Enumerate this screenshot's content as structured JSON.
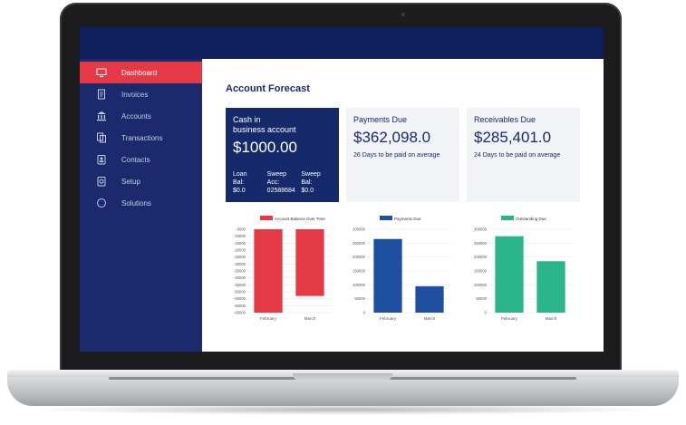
{
  "sidebar": {
    "items": [
      {
        "label": "Dashboard",
        "icon": "monitor-icon",
        "active": true
      },
      {
        "label": "Invoices",
        "icon": "invoice-icon",
        "active": false
      },
      {
        "label": "Accounts",
        "icon": "bank-icon",
        "active": false
      },
      {
        "label": "Transactions",
        "icon": "transactions-icon",
        "active": false
      },
      {
        "label": "Contacts",
        "icon": "contacts-icon",
        "active": false
      },
      {
        "label": "Setup",
        "icon": "setup-icon",
        "active": false
      },
      {
        "label": "Solutions",
        "icon": "circle-icon",
        "active": false
      }
    ]
  },
  "main": {
    "title": "Account Forecast",
    "cash_card": {
      "label_line1": "Cash in",
      "label_line2": "business account",
      "value": "$1000.00",
      "sub": [
        {
          "l1": "Loan",
          "l2": "Bal:",
          "l3": "$0.0"
        },
        {
          "l1": "Sweep",
          "l2": "Acc:",
          "l3": "02588684"
        },
        {
          "l1": "Sweep",
          "l2": "Bal:",
          "l3": "$0.0"
        }
      ]
    },
    "payments_card": {
      "label": "Payments Due",
      "value": "$362,098.0",
      "note": "26 Days to be paid on average"
    },
    "receivables_card": {
      "label": "Receivables Due",
      "value": "$285,401.0",
      "note": "24 Days to be paid on average"
    }
  },
  "colors": {
    "topbar": "#0f1f5c",
    "sidebar": "#1a2a6c",
    "accent": "#e63946",
    "bar_red": "#e63946",
    "bar_blue": "#1f4fa0",
    "bar_green": "#2bb58a"
  },
  "chart_data": [
    {
      "type": "bar",
      "legend": "Account Balance Over Time",
      "categories": [
        "February",
        "March"
      ],
      "values": [
        -65000,
        -52000
      ],
      "ylim": [
        -65000,
        0
      ],
      "yticks": [
        "-5000",
        "-10000",
        "-15000",
        "-20000",
        "-25000",
        "-30000",
        "-35000",
        "-40000",
        "-45000",
        "-50000",
        "-55000",
        "-60000",
        "-65000"
      ],
      "color": "#e63946"
    },
    {
      "type": "bar",
      "legend": "Payments Due",
      "categories": [
        "February",
        "March"
      ],
      "values": [
        265000,
        95000
      ],
      "ylim": [
        0,
        300000
      ],
      "yticks": [
        "300000",
        "250000",
        "200000",
        "150000",
        "100000",
        "50000",
        "0"
      ],
      "color": "#1f4fa0"
    },
    {
      "type": "bar",
      "legend": "Outstanding Due",
      "categories": [
        "February",
        "March"
      ],
      "values": [
        275000,
        185000
      ],
      "ylim": [
        0,
        300000
      ],
      "yticks": [
        "300000",
        "250000",
        "200000",
        "150000",
        "100000",
        "50000",
        "0"
      ],
      "color": "#2bb58a"
    }
  ]
}
